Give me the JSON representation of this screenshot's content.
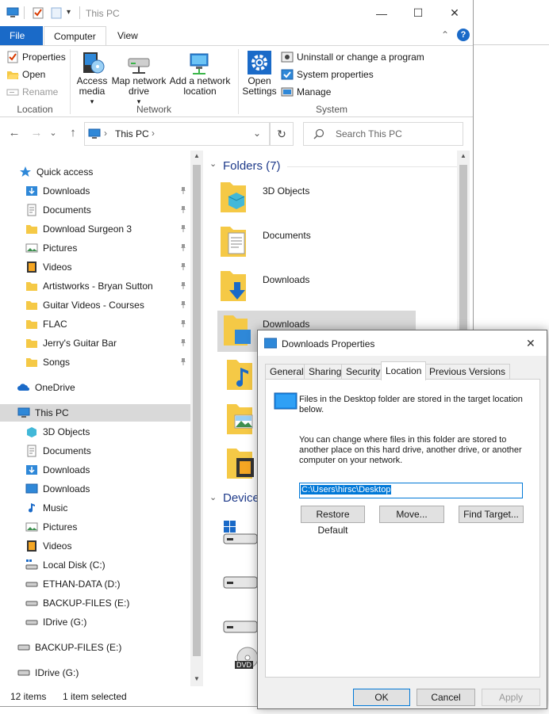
{
  "window": {
    "title": "This PC",
    "qat_dropdown": "▾",
    "minimize": "—",
    "maximize": "☐",
    "close": "✕"
  },
  "ribbon_tabs": [
    "File",
    "Computer",
    "View"
  ],
  "ribbon_help": "?",
  "ribbon_collapse": "⌃",
  "ribbon": {
    "location": {
      "label": "Location",
      "properties": "Properties",
      "open": "Open",
      "rename": "Rename"
    },
    "network": {
      "label": "Network",
      "access_media": "Access media",
      "map_network_drive": "Map network drive",
      "add_network_location": "Add a network location"
    },
    "system": {
      "label": "System",
      "open_settings": "Open Settings",
      "uninstall": "Uninstall or change a program",
      "system_properties": "System properties",
      "manage": "Manage"
    }
  },
  "address": {
    "back": "←",
    "forward": "→",
    "history": "⌄",
    "up": "↑",
    "sep1": "›",
    "path": "This PC",
    "sep2": "›",
    "dropdown": "⌄",
    "refresh": "↻",
    "search_placeholder": "Search This PC"
  },
  "nav": {
    "quick_access": "Quick access",
    "pinned": [
      "Downloads",
      "Documents",
      "Download Surgeon 3",
      "Pictures",
      "Videos",
      "Artistworks - Bryan Sutton",
      "Guitar Videos - Courses",
      "FLAC",
      "Jerry's Guitar Bar",
      "Songs"
    ],
    "onedrive": "OneDrive",
    "this_pc": "This PC",
    "this_pc_items": [
      "3D Objects",
      "Documents",
      "Downloads",
      "Downloads",
      "Music",
      "Pictures",
      "Videos",
      "Local Disk (C:)",
      "ETHAN-DATA (D:)",
      "BACKUP-FILES (E:)",
      "IDrive (G:)"
    ],
    "extra": [
      "BACKUP-FILES (E:)",
      "IDrive (G:)"
    ]
  },
  "content": {
    "folders_header": "Folders (7)",
    "folders": [
      "3D Objects",
      "Documents",
      "Downloads",
      "Downloads"
    ],
    "devices_header": "Device",
    "dvd_label": "DVD"
  },
  "status": {
    "items": "12 items",
    "selected": "1 item selected"
  },
  "dialog": {
    "title": "Downloads Properties",
    "close": "✕",
    "tabs": [
      "General",
      "Sharing",
      "Security",
      "Location",
      "Previous Versions"
    ],
    "active_tab": "Location",
    "info1": "Files in the Desktop folder are stored in the target location below.",
    "info2": "You can change where files in this folder are stored to another place on this hard drive, another drive, or another computer on your network.",
    "path": "C:\\Users\\hirsc\\Desktop",
    "restore_default": "Restore Default",
    "move": "Move...",
    "find_target": "Find Target...",
    "ok": "OK",
    "cancel": "Cancel",
    "apply": "Apply"
  },
  "colors": {
    "accent": "#1a6ac8",
    "folder": "#f5c946",
    "selection": "#d9d9d9",
    "header_blue": "#1e3a8a"
  }
}
